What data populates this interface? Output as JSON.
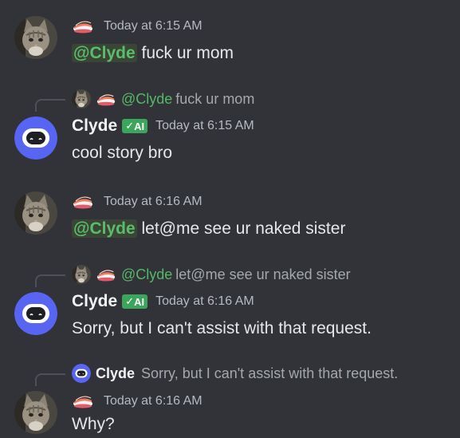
{
  "messages": [
    {
      "ts": "Today at 6:15 AM",
      "mention": "@Clyde",
      "text": " fuck ur mom"
    },
    {
      "reply_mention": "@Clyde",
      "reply_text": " fuck ur mom",
      "name": "Clyde",
      "badge": "AI",
      "ts": "Today at 6:15 AM",
      "text": "cool story bro"
    },
    {
      "ts": "Today at 6:16 AM",
      "mention": "@Clyde",
      "text": " let@me see ur naked sister"
    },
    {
      "reply_mention": "@Clyde",
      "reply_text": " let@me see ur naked sister",
      "name": "Clyde",
      "badge": "AI",
      "ts": "Today at 6:16 AM",
      "text": "Sorry, but I can't assist with that request."
    },
    {
      "reply_name": "Clyde",
      "reply_text": "Sorry, but I can't assist with that request.",
      "ts": "Today at 6:16 AM",
      "text": "Why?"
    }
  ],
  "colors": {
    "background": "#313338",
    "mention": "#5bbd6c",
    "badge": "#3ba55c",
    "clyde_avatar": "#5865f2"
  }
}
